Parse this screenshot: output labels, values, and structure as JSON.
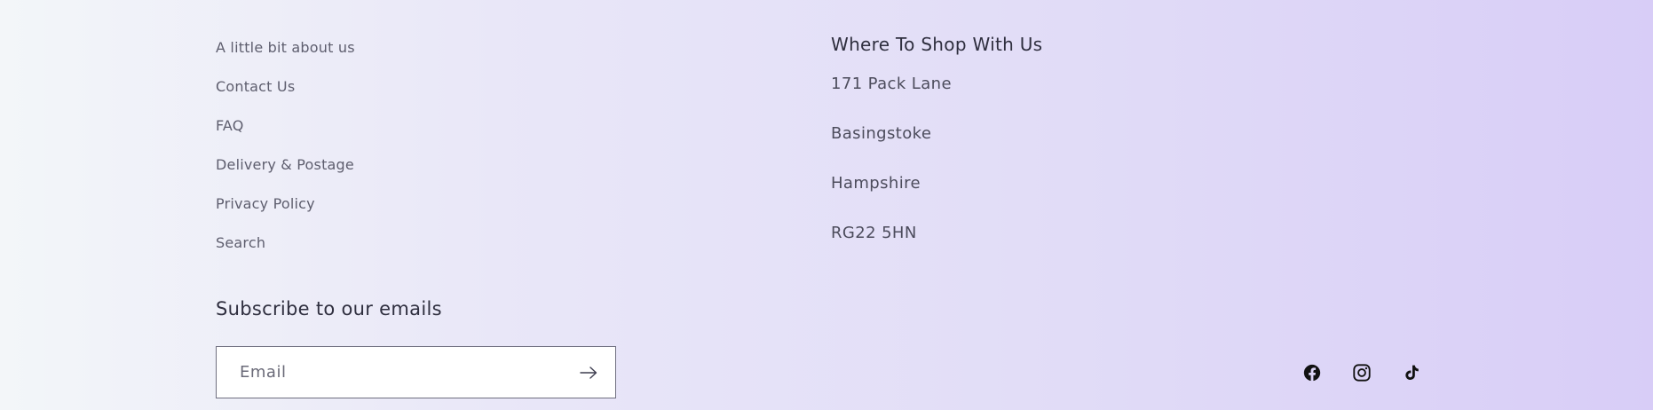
{
  "footer": {
    "links": [
      "A little bit about us",
      "Contact Us",
      "FAQ",
      "Delivery & Postage",
      "Privacy Policy",
      "Search"
    ],
    "shop": {
      "heading": "Where To Shop With Us",
      "address": [
        "171 Pack Lane",
        "Basingstoke",
        "Hampshire",
        "RG22 5HN"
      ]
    },
    "subscribe": {
      "heading": "Subscribe to our emails",
      "email_placeholder": "Email",
      "submit_icon": "arrow-right-icon"
    },
    "social": {
      "icons": [
        "facebook-icon",
        "instagram-icon",
        "tiktok-icon"
      ]
    }
  }
}
